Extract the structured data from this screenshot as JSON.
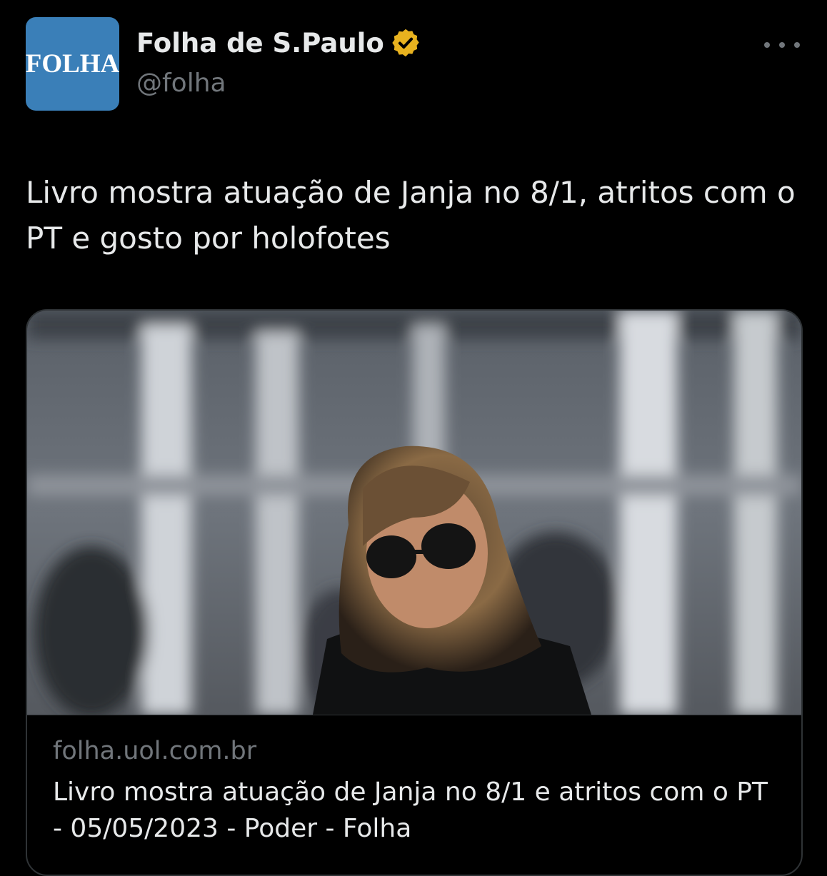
{
  "account": {
    "avatar_text": "FOLHA",
    "display_name": "Folha de S.Paulo",
    "handle": "@folha",
    "verified_badge": "verified-badge-icon",
    "avatar_color": "#3a7fb8",
    "badge_color": "#e8b21f"
  },
  "tweet": {
    "text": "Livro mostra atuação de Janja no 8/1, atritos com o PT e gosto por holofotes"
  },
  "link_card": {
    "image_alt": "",
    "domain": "folha.uol.com.br",
    "title": "Livro mostra atuação de Janja no 8/1 e atritos com o PT - 05/05/2023 - Poder - Folha"
  },
  "icons": {
    "more": "more-options-icon"
  }
}
